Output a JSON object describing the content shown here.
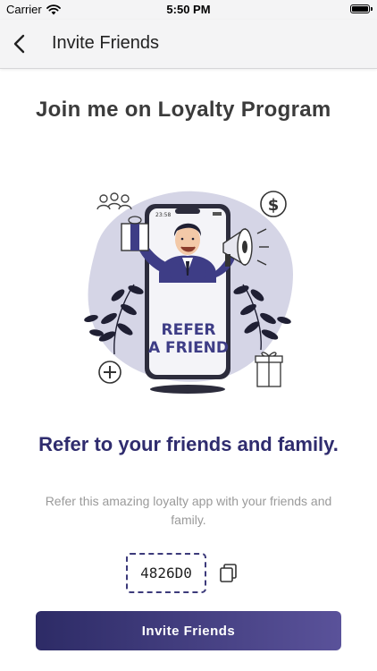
{
  "status_bar": {
    "carrier": "Carrier",
    "time": "5:50 PM",
    "icons": [
      "wifi-icon",
      "battery-icon"
    ]
  },
  "nav": {
    "title": "Invite Friends",
    "back_icon": "chevron-left-icon"
  },
  "main": {
    "heading": "Join me on Loyalty Program",
    "illustration": {
      "poster_line1": "REFER",
      "poster_line2": "A FRIEND",
      "phone_time": "23:58"
    },
    "subheading": "Refer to your friends and family.",
    "description": "Refer this amazing loyalty app with your friends and family.",
    "referral_code": "4826D0",
    "copy_icon": "copy-icon",
    "invite_button_label": "Invite Friends"
  },
  "colors": {
    "primary": "#2f2c6e",
    "button_gradient_start": "#2d2b66",
    "button_gradient_end": "#5a529a",
    "blob": "#d5d5e6"
  }
}
